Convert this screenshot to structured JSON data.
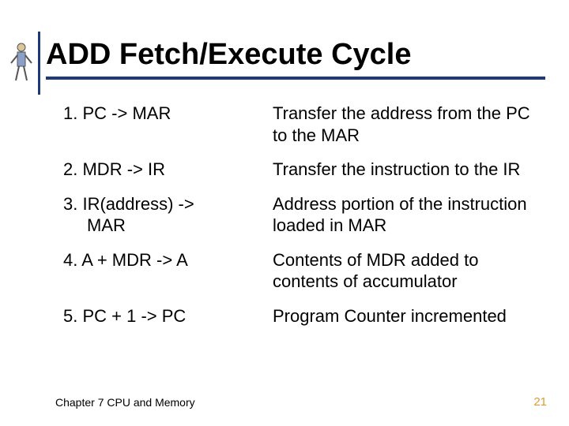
{
  "title": "ADD Fetch/Execute Cycle",
  "rows": [
    {
      "num": "1.",
      "step": "PC -> MAR",
      "desc": "Transfer the address from the PC to the MAR"
    },
    {
      "num": "2.",
      "step": "MDR -> IR",
      "desc": "Transfer the instruction to the IR"
    },
    {
      "num": "3.",
      "step": "IR(address) -> MAR",
      "desc": "Address portion of the instruction loaded in MAR"
    },
    {
      "num": "4.",
      "step": "A + MDR -> A",
      "desc": "Contents of MDR added to contents of accumulator"
    },
    {
      "num": "5.",
      "step": "PC + 1 -> PC",
      "desc": "Program Counter incremented"
    }
  ],
  "footer": {
    "chapter": "Chapter 7 CPU and Memory",
    "page": "21"
  },
  "icon": "decorative-figure"
}
